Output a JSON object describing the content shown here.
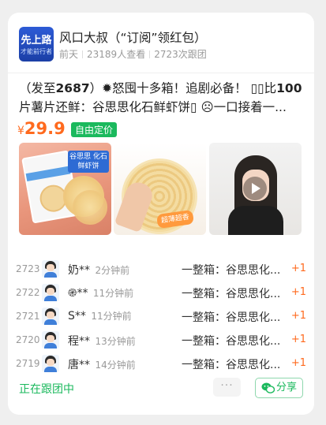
{
  "group": {
    "name": "风口大叔（“订阅”领红包）",
    "time": "前天",
    "views": "23189人查看",
    "joined": "2723次跟团",
    "avatar_text_top": "先上路",
    "avatar_text_bottom": "才能前行者"
  },
  "post": {
    "line1_prefix": "（发至",
    "line1_bold": "2687",
    "line1_rest": "）✹怒囤十多箱！追剧必备！ ▯▯比",
    "line1_bold2": "100",
    "line2": "片薯片还鲜：谷思思化石鲜虾饼▯ ☹一口接着一...",
    "price_symbol": "¥",
    "price_value": "29.9",
    "price_tag": "自由定价"
  },
  "images": {
    "img1_banner": "谷思思 化石鲜虾饼",
    "img2_sticker": "超薄超香"
  },
  "orders": [
    {
      "num": "2723",
      "user": "奶**",
      "time": "2分钟前",
      "item": "一整箱：谷思思化...",
      "qty": "+1"
    },
    {
      "num": "2722",
      "user": "֎**",
      "time": "11分钟前",
      "item": "一整箱：谷思思化...",
      "qty": "+1"
    },
    {
      "num": "2721",
      "user": "S**",
      "time": "11分钟前",
      "item": "一整箱：谷思思化...",
      "qty": "+1"
    },
    {
      "num": "2720",
      "user": "程**",
      "time": "13分钟前",
      "item": "一整箱：谷思思化...",
      "qty": "+1"
    },
    {
      "num": "2719",
      "user": "唐**",
      "time": "14分钟前",
      "item": "一整箱：谷思思化...",
      "qty": "+1"
    }
  ],
  "footer": {
    "status": "正在跟团中",
    "more": "···",
    "share": "分享"
  },
  "colors": {
    "accent_green": "#1bb95d",
    "price_orange": "#ff6a1e"
  }
}
